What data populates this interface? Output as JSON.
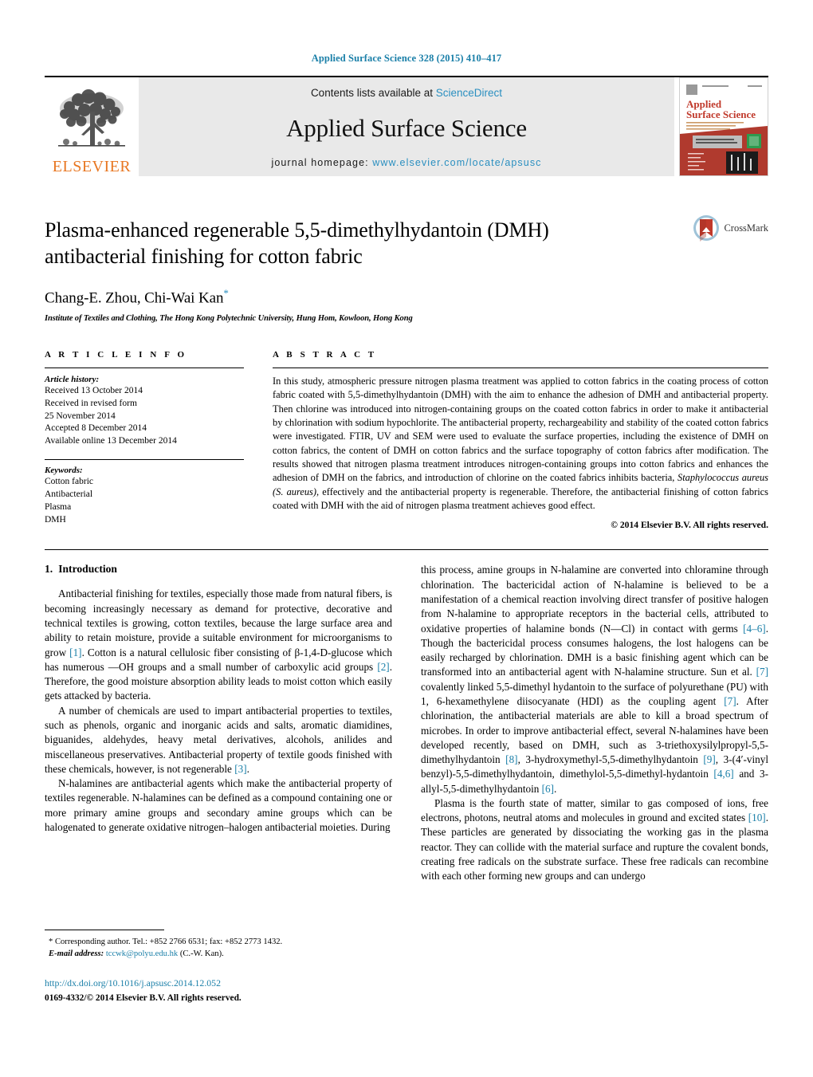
{
  "running_head": "Applied Surface Science 328 (2015) 410–417",
  "masthead": {
    "publisher_name": "ELSEVIER",
    "contents_prefix": "Contents lists available at ",
    "contents_link": "ScienceDirect",
    "journal_title": "Applied Surface Science",
    "homepage_prefix": "journal homepage: ",
    "homepage_url": "www.elsevier.com/locate/apsusc",
    "cover": {
      "title_line1": "Applied",
      "title_line2": "Surface Science"
    }
  },
  "article": {
    "title": "Plasma-enhanced regenerable 5,5-dimethylhydantoin (DMH) antibacterial finishing for cotton fabric",
    "authors": "Chang-E. Zhou, Chi-Wai Kan",
    "corresponding_marker": "*",
    "affiliation": "Institute of Textiles and Clothing, The Hong Kong Polytechnic University, Hung Hom, Kowloon, Hong Kong",
    "crossmark_label": "CrossMark"
  },
  "article_info": {
    "heading": "A R T I C L E   I N F O",
    "history_label": "Article history:",
    "history": [
      "Received 13 October 2014",
      "Received in revised form",
      "25 November 2014",
      "Accepted 8 December 2014",
      "Available online 13 December 2014"
    ],
    "keywords_label": "Keywords:",
    "keywords": [
      "Cotton fabric",
      "Antibacterial",
      "Plasma",
      "DMH"
    ]
  },
  "abstract": {
    "heading": "A B S T R A C T",
    "text": "In this study, atmospheric pressure nitrogen plasma treatment was applied to cotton fabrics in the coating process of cotton fabric coated with 5,5-dimethylhydantoin (DMH) with the aim to enhance the adhesion of DMH and antibacterial property. Then chlorine was introduced into nitrogen-containing groups on the coated cotton fabrics in order to make it antibacterial by chlorination with sodium hypochlorite. The antibacterial property, rechargeability and stability of the coated cotton fabrics were investigated. FTIR, UV and SEM were used to evaluate the surface properties, including the existence of DMH on cotton fabrics, the content of DMH on cotton fabrics and the surface topography of cotton fabrics after modification. The results showed that nitrogen plasma treatment introduces nitrogen-containing groups into cotton fabrics and enhances the adhesion of DMH on the fabrics, and introduction of chlorine on the coated fabrics inhibits bacteria, Staphylococcus aureus (S. aureus), effectively and the antibacterial property is regenerable. Therefore, the antibacterial finishing of cotton fabrics coated with DMH with the aid of nitrogen plasma treatment achieves good effect.",
    "italic_phrase": "Staphylococcus aureus (S. aureus)",
    "copyright": "© 2014 Elsevier B.V. All rights reserved."
  },
  "introduction": {
    "number": "1.",
    "heading": "Introduction",
    "left_paragraphs": [
      "Antibacterial finishing for textiles, especially those made from natural fibers, is becoming increasingly necessary as demand for protective, decorative and technical textiles is growing, cotton textiles, because the large surface area and ability to retain moisture, provide a suitable environment for microorganisms to grow [1]. Cotton is a natural cellulosic fiber consisting of β-1,4-D-glucose which has numerous —OH groups and a small number of carboxylic acid groups [2]. Therefore, the good moisture absorption ability leads to moist cotton which easily gets attacked by bacteria.",
      "A number of chemicals are used to impart antibacterial properties to textiles, such as phenols, organic and inorganic acids and salts, aromatic diamidines, biguanides, aldehydes, heavy metal derivatives, alcohols, anilides and miscellaneous preservatives. Antibacterial property of textile goods finished with these chemicals, however, is not regenerable [3].",
      "N-halamines are antibacterial agents which make the antibacterial property of textiles regenerable. N-halamines can be defined as a compound containing one or more primary amine groups and secondary amine groups which can be halogenated to generate oxidative nitrogen–halogen antibacterial moieties. During"
    ],
    "right_paragraphs": [
      "this process, amine groups in N-halamine are converted into chloramine through chlorination. The bactericidal action of N-halamine is believed to be a manifestation of a chemical reaction involving direct transfer of positive halogen from N-halamine to appropriate receptors in the bacterial cells, attributed to oxidative properties of halamine bonds (N—Cl) in contact with germs [4–6]. Though the bactericidal process consumes halogens, the lost halogens can be easily recharged by chlorination. DMH is a basic finishing agent which can be transformed into an antibacterial agent with N-halamine structure. Sun et al. [7] covalently linked 5,5-dimethyl hydantoin to the surface of polyurethane (PU) with 1, 6-hexamethylene diisocyanate (HDI) as the coupling agent [7]. After chlorination, the antibacterial materials are able to kill a broad spectrum of microbes. In order to improve antibacterial effect, several N-halamines have been developed recently, based on DMH, such as 3-triethoxysilylpropyl-5,5-dimethylhydantoin [8], 3-hydroxymethyl-5,5-dimethylhydantoin [9], 3-(4′-vinyl benzyl)-5,5-dimethylhydantoin, dimethylol-5,5-dimethyl-hydantoin [4,6] and 3-allyl-5,5-dimethylhydantoin [6].",
      "Plasma is the fourth state of matter, similar to gas composed of ions, free electrons, photons, neutral atoms and molecules in ground and excited states [10]. These particles are generated by dissociating the working gas in the plasma reactor. They can collide with the material surface and rupture the covalent bonds, creating free radicals on the substrate surface. These free radicals can recombine with each other forming new groups and can undergo"
    ]
  },
  "footnote": {
    "corresponding": "* Corresponding author. Tel.: +852 2766 6531; fax: +852 2773 1432.",
    "email_label": "E-mail address:",
    "email": "tccwk@polyu.edu.hk",
    "email_suffix": " (C.-W. Kan)."
  },
  "publication_footer": {
    "doi": "http://dx.doi.org/10.1016/j.apsusc.2014.12.052",
    "issn_copyright": "0169-4332/© 2014 Elsevier B.V. All rights reserved."
  },
  "colors": {
    "link_blue": "#1a7fa8",
    "sciencedirect_blue": "#2a8fc0",
    "elsevier_orange": "#e87722",
    "masthead_gray": "#e9e9e9"
  }
}
